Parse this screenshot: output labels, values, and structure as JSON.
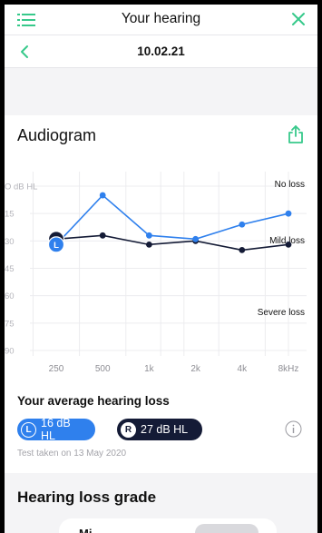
{
  "header": {
    "title": "Your hearing",
    "menu_icon": "menu-icon",
    "close_icon": "close-icon"
  },
  "date_bar": {
    "date": "10.02.21",
    "back_icon": "chevron-left-icon"
  },
  "audiogram": {
    "title": "Audiogram",
    "share_icon": "share-icon",
    "annotations": {
      "no_loss": "No loss",
      "mild_loss": "Mild loss",
      "severe_loss": "Severe loss"
    }
  },
  "chart_data": {
    "type": "line",
    "title": "Audiogram",
    "x_categories": [
      "250",
      "500",
      "1k",
      "2k",
      "4k",
      "8kHz"
    ],
    "y_tick_labels": [
      "O dB HL",
      "15",
      "30",
      "45",
      "60",
      "75",
      "90"
    ],
    "y_ticks": [
      0,
      15,
      30,
      45,
      60,
      75,
      90
    ],
    "ylim": [
      0,
      90
    ],
    "y_inverted": true,
    "x_positions": [
      0,
      1,
      2,
      2.75,
      3.25,
      4,
      5,
      5.5
    ],
    "series": [
      {
        "name": "L",
        "color": "#2f80ed",
        "x": [
          0,
          1,
          2,
          3,
          4,
          5
        ],
        "values": [
          32,
          5,
          27,
          29,
          21,
          15
        ]
      },
      {
        "name": "R",
        "color": "#141b36",
        "x": [
          0,
          1,
          2,
          3,
          4,
          5
        ],
        "values": [
          29,
          27,
          32,
          30,
          35,
          32
        ]
      }
    ],
    "grid": true
  },
  "average": {
    "title": "Your average hearing loss",
    "left": {
      "badge": "L",
      "value": "16 dB HL"
    },
    "right": {
      "badge": "R",
      "value": "27 dB HL"
    },
    "info_icon": "info-icon",
    "test_date": "Test taken on 13 May 2020"
  },
  "grade": {
    "title": "Hearing loss grade",
    "card_label": "Mi"
  },
  "colors": {
    "accent_green": "#37c98b",
    "left_blue": "#2f80ed",
    "right_navy": "#141b36"
  }
}
